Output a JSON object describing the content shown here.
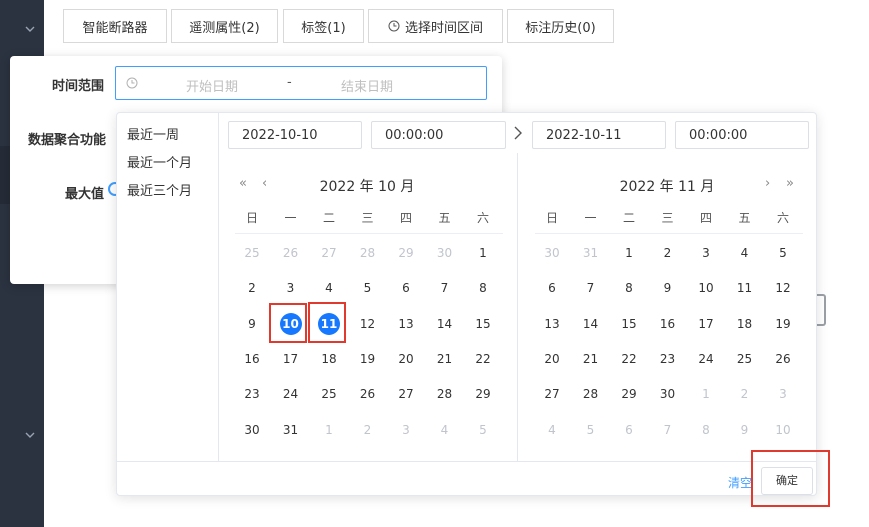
{
  "tabs": [
    {
      "label": "智能断路器"
    },
    {
      "label": "遥测属性(2)"
    },
    {
      "label": "标签(1)"
    },
    {
      "label": "选择时间区间",
      "icon": "clock-icon"
    },
    {
      "label": "标注历史(0)"
    }
  ],
  "form": {
    "time_range_label": "时间范围",
    "start_placeholder": "开始日期",
    "range_separator": "-",
    "end_placeholder": "结束日期",
    "aggregate_label": "数据聚合功能",
    "max_label": "最大值"
  },
  "picker": {
    "shortcuts": [
      "最近一周",
      "最近一个月",
      "最近三个月"
    ],
    "start_date": "2022-10-10",
    "start_time": "00:00:00",
    "end_date": "2022-10-11",
    "end_time": "00:00:00",
    "weekdays": [
      "日",
      "一",
      "二",
      "三",
      "四",
      "五",
      "六"
    ],
    "left": {
      "title": "2022 年 10 月",
      "days": [
        [
          "25",
          "26",
          "27",
          "28",
          "29",
          "30",
          "1"
        ],
        [
          "2",
          "3",
          "4",
          "5",
          "6",
          "7",
          "8"
        ],
        [
          "9",
          "10",
          "11",
          "12",
          "13",
          "14",
          "15"
        ],
        [
          "16",
          "17",
          "18",
          "19",
          "20",
          "21",
          "22"
        ],
        [
          "23",
          "24",
          "25",
          "26",
          "27",
          "28",
          "29"
        ],
        [
          "30",
          "31",
          "1",
          "2",
          "3",
          "4",
          "5"
        ]
      ],
      "muted": [
        [
          0,
          0
        ],
        [
          0,
          1
        ],
        [
          0,
          2
        ],
        [
          0,
          3
        ],
        [
          0,
          4
        ],
        [
          0,
          5
        ],
        [
          5,
          2
        ],
        [
          5,
          3
        ],
        [
          5,
          4
        ],
        [
          5,
          5
        ],
        [
          5,
          6
        ]
      ],
      "selected": [
        [
          2,
          1
        ],
        [
          2,
          2
        ]
      ]
    },
    "right": {
      "title": "2022 年 11 月",
      "days": [
        [
          "30",
          "31",
          "1",
          "2",
          "3",
          "4",
          "5"
        ],
        [
          "6",
          "7",
          "8",
          "9",
          "10",
          "11",
          "12"
        ],
        [
          "13",
          "14",
          "15",
          "16",
          "17",
          "18",
          "19"
        ],
        [
          "20",
          "21",
          "22",
          "23",
          "24",
          "25",
          "26"
        ],
        [
          "27",
          "28",
          "29",
          "30",
          "1",
          "2",
          "3"
        ],
        [
          "4",
          "5",
          "6",
          "7",
          "8",
          "9",
          "10"
        ]
      ],
      "muted": [
        [
          0,
          0
        ],
        [
          0,
          1
        ],
        [
          4,
          4
        ],
        [
          4,
          5
        ],
        [
          4,
          6
        ],
        [
          5,
          0
        ],
        [
          5,
          1
        ],
        [
          5,
          2
        ],
        [
          5,
          3
        ],
        [
          5,
          4
        ],
        [
          5,
          5
        ],
        [
          5,
          6
        ]
      ],
      "selected": []
    },
    "clear_label": "清空",
    "ok_label": "确定"
  },
  "colors": {
    "accent": "#409eff",
    "selected": "#1677ff",
    "highlight": "#e03a2e",
    "sidebar_bg": "#2b3240"
  }
}
